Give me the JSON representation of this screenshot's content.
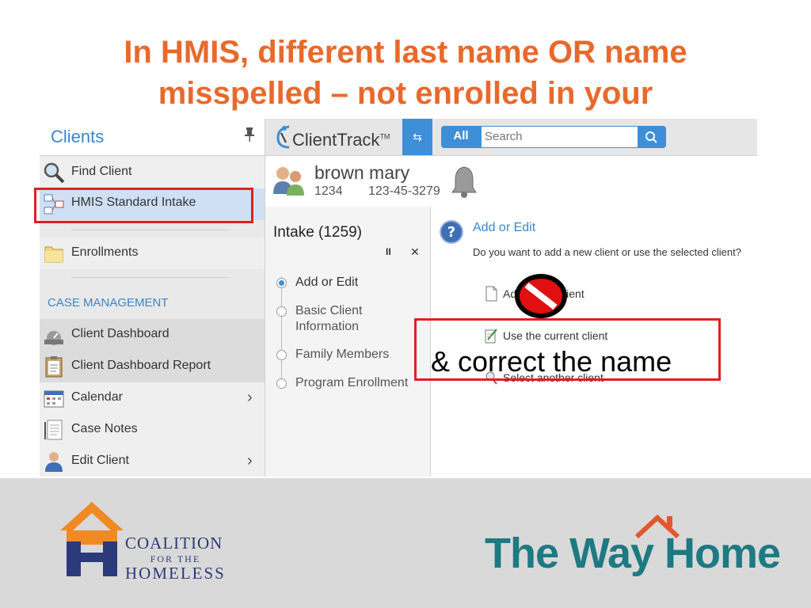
{
  "slide": {
    "title_line1": "In HMIS, different last name OR name",
    "title_line2": "misspelled – not enrolled in your",
    "annotation": "& correct the name"
  },
  "sidebar": {
    "title": "Clients",
    "items": [
      {
        "label": "Find Client",
        "icon": "magnifier-icon"
      },
      {
        "label": "HMIS Standard Intake",
        "icon": "workflow-icon"
      },
      {
        "label": "Enrollments",
        "icon": "folder-icon"
      }
    ],
    "section_label": "CASE MANAGEMENT",
    "case_items": [
      {
        "label": "Client Dashboard",
        "icon": "dashboard-icon"
      },
      {
        "label": "Client Dashboard Report",
        "icon": "clipboard-icon"
      },
      {
        "label": "Calendar",
        "icon": "calendar-icon",
        "chevron": "›"
      },
      {
        "label": "Case Notes",
        "icon": "notes-icon"
      },
      {
        "label": "Edit Client",
        "icon": "person-icon",
        "chevron": "›"
      }
    ]
  },
  "topbar": {
    "logo": "ClientTrack",
    "logo_tm": "TM",
    "swap_icon": "⇆",
    "all_label": "All",
    "search_placeholder": "Search"
  },
  "client": {
    "name": "brown mary",
    "id": "1234",
    "ssn": "123-45-3279"
  },
  "workflow": {
    "title": "Intake (1259)",
    "pause": "II",
    "close": "✕",
    "steps": [
      {
        "label": "Add or Edit"
      },
      {
        "label": "Basic Client"
      },
      {
        "label": "Information"
      },
      {
        "label": "Family Members"
      },
      {
        "label": "Program Enrollment"
      }
    ]
  },
  "content": {
    "heading": "Add or Edit",
    "question": "Do you want to add a new client or use the selected client?",
    "options": [
      {
        "label": "Add a new client"
      },
      {
        "label": "Use the current client"
      },
      {
        "label": "Select another client"
      }
    ]
  },
  "footer": {
    "coalition_line1": "COALITION",
    "coalition_line2": "FOR THE",
    "coalition_line3": "HOMELESS",
    "wayhome": "The Way Home"
  },
  "colors": {
    "title": "#E8692B",
    "accent_blue": "#3f8fd8",
    "highlight_red": "#e02020",
    "wayhome_teal": "#1d7a82",
    "coalition_navy": "#2c3a7a"
  }
}
